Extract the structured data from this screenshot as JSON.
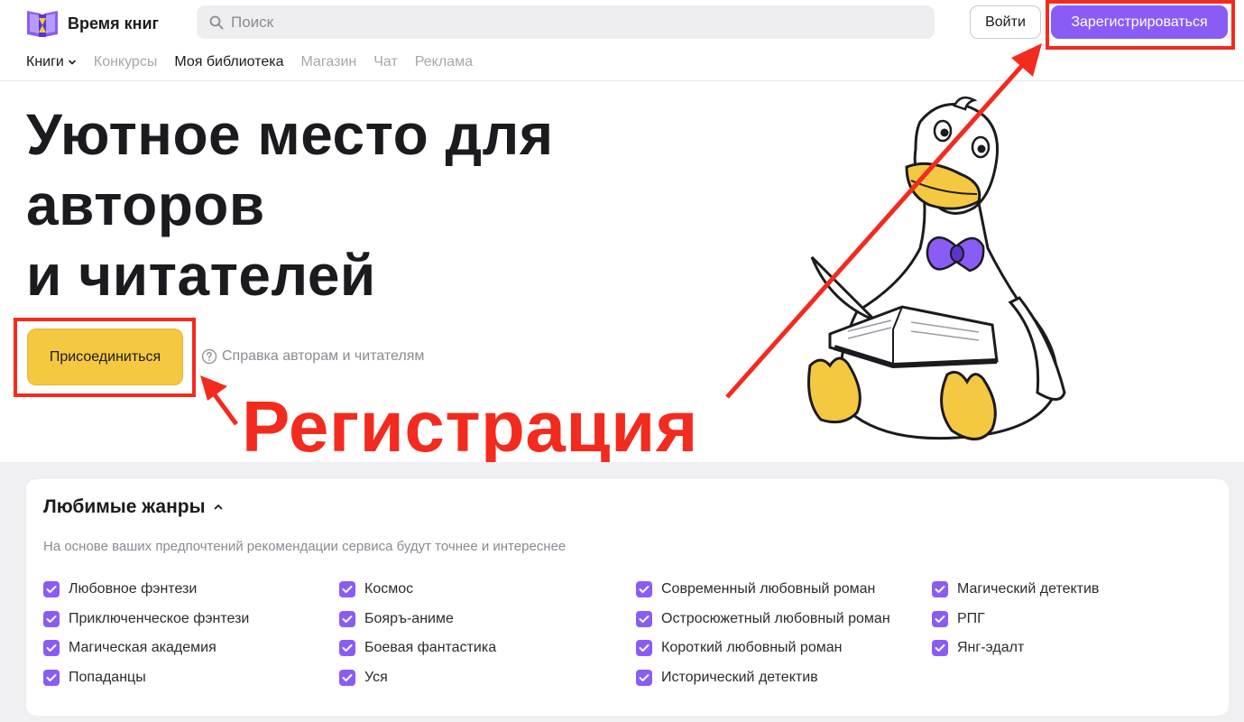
{
  "header": {
    "logo_text": "Время книг",
    "search_placeholder": "Поиск",
    "login_label": "Войти",
    "register_label": "Зарегистрироваться"
  },
  "nav": [
    {
      "label": "Книги",
      "active": true,
      "has_dropdown": true
    },
    {
      "label": "Конкурсы",
      "active": false
    },
    {
      "label": "Моя библиотека",
      "active": true
    },
    {
      "label": "Магазин",
      "active": false
    },
    {
      "label": "Чат",
      "active": false
    },
    {
      "label": "Реклама",
      "active": false
    }
  ],
  "hero": {
    "title_lines": [
      "Уютное место для",
      "авторов",
      "и читателей"
    ],
    "join_label": "Присоединиться",
    "help_link": "Справка авторам и читателям"
  },
  "annotation": {
    "text": "Регистрация",
    "color": "#f22b1e"
  },
  "genres": {
    "title": "Любимые жанры",
    "subtitle": "На основе ваших предпочтений рекомендации сервиса будут точнее и интереснее",
    "columns": [
      [
        "Любовное фэнтези",
        "Приключенческое фэнтези",
        "Магическая академия",
        "Попаданцы"
      ],
      [
        "Космос",
        "Бояръ-аниме",
        "Боевая фантастика",
        "Уся"
      ],
      [
        "Современный любовный роман",
        "Остросюжетный любовный роман",
        "Короткий любовный роман",
        "Исторический детектив"
      ],
      [
        "Магический детектив",
        "РПГ",
        "Янг-эдалт"
      ]
    ],
    "checked": true
  },
  "colors": {
    "accent": "#8a5cf6",
    "join_button": "#f5c842",
    "annotation": "#f22b1e"
  },
  "icons": {
    "search": "search-icon",
    "help": "question-circle-icon",
    "chevron_down": "chevron-down-icon",
    "chevron_up": "chevron-up-icon",
    "check": "check-icon"
  }
}
